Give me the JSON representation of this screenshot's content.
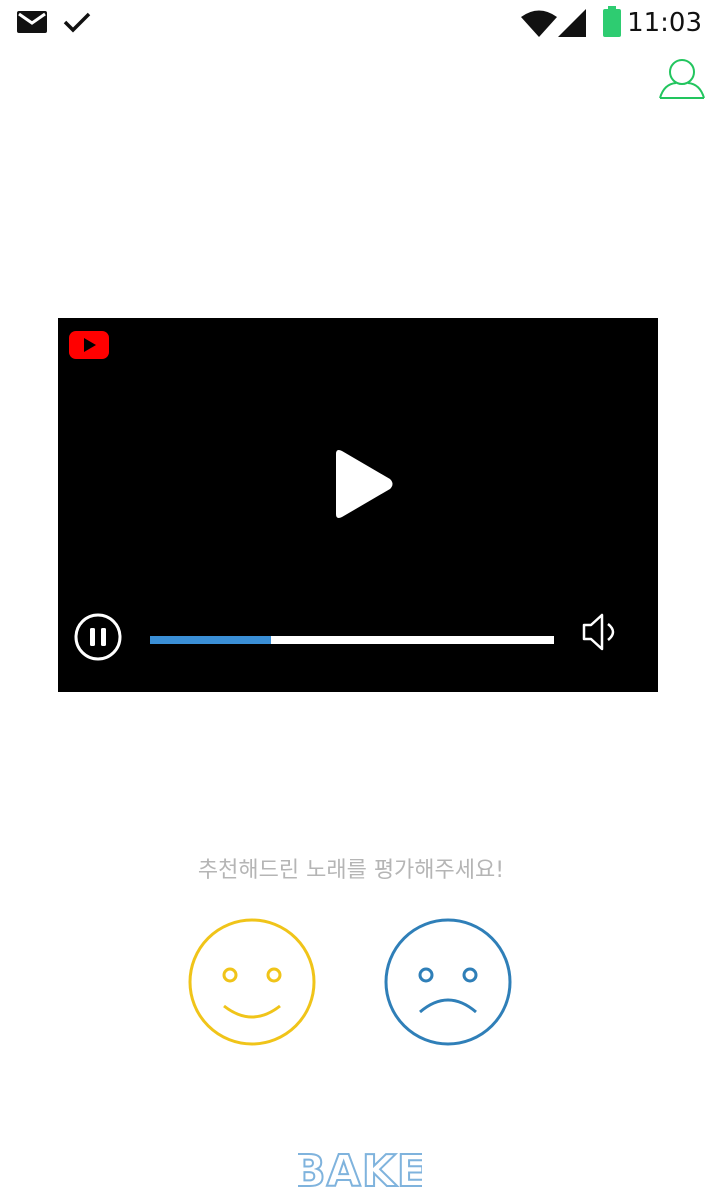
{
  "status_bar": {
    "time": "11:03",
    "icons": [
      "mail-icon",
      "check-icon",
      "wifi-icon",
      "signal-icon",
      "battery-icon"
    ],
    "battery_color": "#2ecc71"
  },
  "header": {
    "profile_icon": "user-outline-icon",
    "accent_color": "#22c55e"
  },
  "video": {
    "platform_icon": "youtube-icon",
    "progress_fraction": 0.3,
    "progress_color": "#3a8fd6",
    "controls": [
      "play-icon",
      "pause-icon",
      "volume-icon"
    ]
  },
  "rating": {
    "prompt": "추천해드린 노래를 평가해주세요!",
    "like_icon": "smiley-face-icon",
    "like_color": "#f0c419",
    "dislike_icon": "sad-face-icon",
    "dislike_color": "#2f7fb8"
  },
  "footer": {
    "logo_text": "BAKE"
  }
}
